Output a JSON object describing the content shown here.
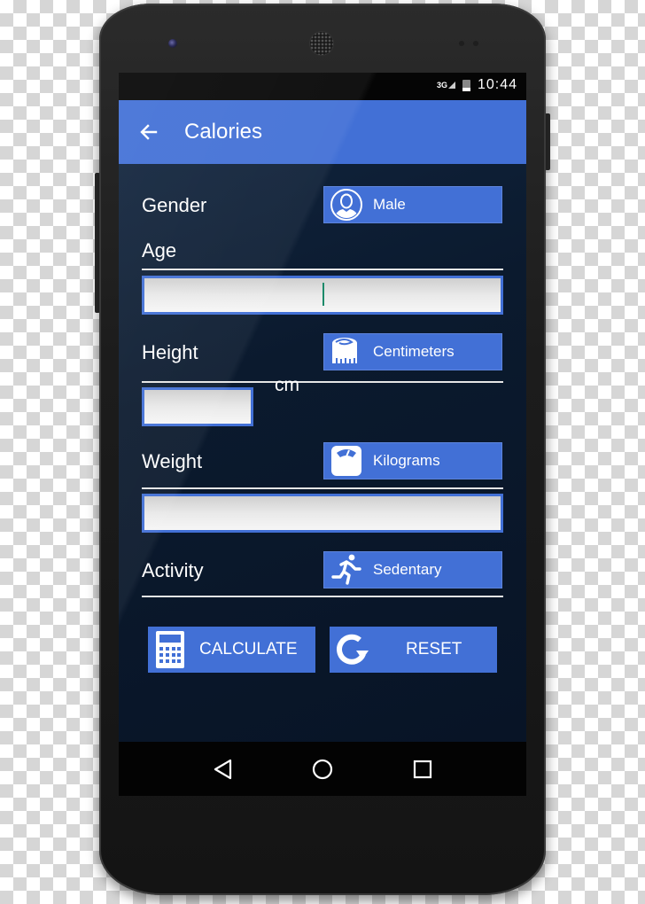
{
  "status_bar": {
    "network": "3G",
    "time": "10:44"
  },
  "app_bar": {
    "title": "Calories",
    "back_icon": "arrow-left-icon"
  },
  "form": {
    "gender": {
      "label": "Gender",
      "value": "Male",
      "icon": "person-avatar-icon"
    },
    "age": {
      "label": "Age",
      "value": "",
      "placeholder": ""
    },
    "height": {
      "label": "Height",
      "unit_selector": "Centimeters",
      "icon": "tape-measure-icon",
      "value": "",
      "unit_suffix": "cm"
    },
    "weight": {
      "label": "Weight",
      "unit_selector": "Kilograms",
      "icon": "scale-icon",
      "value": ""
    },
    "activity": {
      "label": "Activity",
      "value": "Sedentary",
      "icon": "running-icon"
    }
  },
  "buttons": {
    "calculate": {
      "label": "CALCULATE",
      "icon": "calculator-icon"
    },
    "reset": {
      "label": "RESET",
      "icon": "refresh-icon"
    }
  },
  "nav_bar": {
    "back": "triangle-back-icon",
    "home": "circle-home-icon",
    "recents": "square-recents-icon"
  },
  "colors": {
    "accent": "#4270d6",
    "background": "#0b1a2e",
    "caret": "#1c8a6a"
  }
}
